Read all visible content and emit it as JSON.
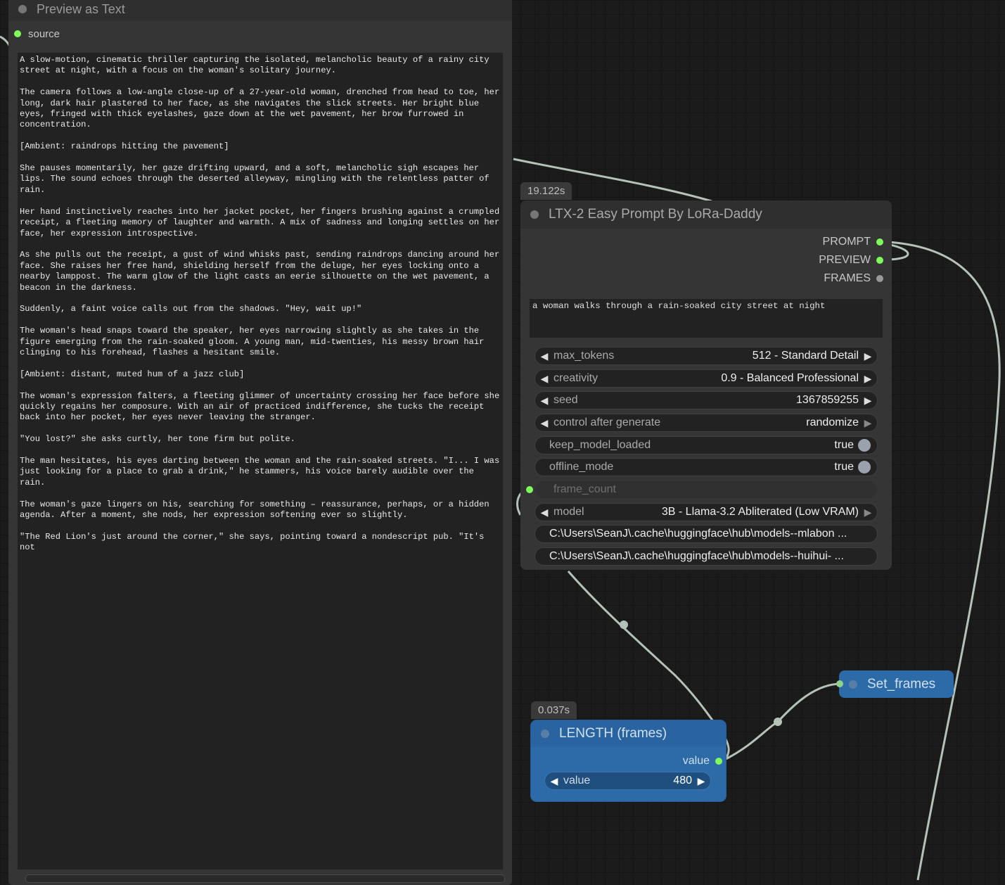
{
  "preview_node": {
    "title": "Preview as Text",
    "input_label": "source",
    "text": "A slow-motion, cinematic thriller capturing the isolated, melancholic beauty of a rainy city\nstreet at night, with a focus on the woman's solitary journey.\n\nThe camera follows a low-angle close-up of a 27-year-old woman, drenched from head to toe, her\nlong, dark hair plastered to her face, as she navigates the slick streets. Her bright blue\neyes, fringed with thick eyelashes, gaze down at the wet pavement, her brow furrowed in\nconcentration.\n\n[Ambient: raindrops hitting the pavement]\n\nShe pauses momentarily, her gaze drifting upward, and a soft, melancholic sigh escapes her\nlips. The sound echoes through the deserted alleyway, mingling with the relentless patter of\nrain.\n\nHer hand instinctively reaches into her jacket pocket, her fingers brushing against a crumpled\nreceipt, a fleeting memory of laughter and warmth. A mix of sadness and longing settles on her\nface, her expression introspective.\n\nAs she pulls out the receipt, a gust of wind whisks past, sending raindrops dancing around her\nface. She raises her free hand, shielding herself from the deluge, her eyes locking onto a\nnearby lamppost. The warm glow of the light casts an eerie silhouette on the wet pavement, a\nbeacon in the darkness.\n\nSuddenly, a faint voice calls out from the shadows. \"Hey, wait up!\"\n\nThe woman's head snaps toward the speaker, her eyes narrowing slightly as she takes in the\nfigure emerging from the rain-soaked gloom. A young man, mid-twenties, his messy brown hair\nclinging to his forehead, flashes a hesitant smile.\n\n[Ambient: distant, muted hum of a jazz club]\n\nThe woman's expression falters, a fleeting glimmer of uncertainty crossing her face before she\nquickly regains her composure. With an air of practiced indifference, she tucks the receipt\nback into her pocket, her eyes never leaving the stranger.\n\n\"You lost?\" she asks curtly, her tone firm but polite.\n\nThe man hesitates, his eyes darting between the woman and the rain-soaked streets. \"I... I was\njust looking for a place to grab a drink,\" he stammers, his voice barely audible over the\nrain.\n\nThe woman's gaze lingers on his, searching for something – reassurance, perhaps, or a hidden\nagenda. After a moment, she nods, her expression softening ever so slightly.\n\n\"The Red Lion's just around the corner,\" she says, pointing toward a nondescript pub. \"It's\nnot"
  },
  "ltx_node": {
    "time": "19.122s",
    "title": "LTX-2 Easy Prompt By LoRa-Daddy",
    "outputs": [
      "PROMPT",
      "PREVIEW",
      "FRAMES"
    ],
    "prompt_text": "a woman walks through a rain-soaked city street at night",
    "widgets": {
      "max_tokens": {
        "name": "max_tokens",
        "value": "512 - Standard Detail"
      },
      "creativity": {
        "name": "creativity",
        "value": "0.9 - Balanced Professional"
      },
      "seed": {
        "name": "seed",
        "value": "1367859255"
      },
      "control": {
        "name": "control after generate",
        "value": "randomize"
      },
      "keep_loaded": {
        "name": "keep_model_loaded",
        "value": "true"
      },
      "offline": {
        "name": "offline_mode",
        "value": "true"
      },
      "frame_count": {
        "name": "frame_count"
      },
      "model": {
        "name": "model",
        "value": "3B - Llama-3.2 Abliterated (Low VRAM)"
      },
      "path1": "C:\\Users\\SeanJ\\.cache\\huggingface\\hub\\models--mlabon ...",
      "path2": "C:\\Users\\SeanJ\\.cache\\huggingface\\hub\\models--huihui- ..."
    }
  },
  "length_node": {
    "time": "0.037s",
    "title": "LENGTH (frames)",
    "output": "value",
    "widget_name": "value",
    "widget_value": "480"
  },
  "set_node": {
    "title": "Set_frames"
  },
  "icons": {
    "left_arrow": "◀",
    "right_arrow": "▶"
  }
}
